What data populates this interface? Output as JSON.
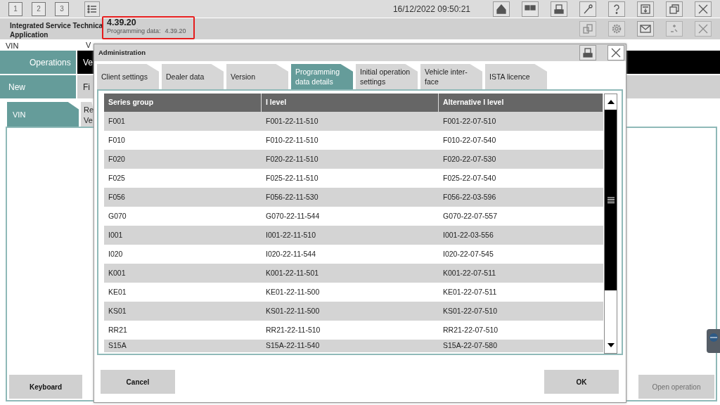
{
  "toolbar": {
    "screens": [
      "1",
      "2",
      "3"
    ],
    "datetime": "16/12/2022 09:50:21"
  },
  "header": {
    "app_title_lines": [
      "Integrated Service Technica",
      "Application"
    ],
    "version": "4.39.20",
    "programming_data_label": "Programming data:",
    "programming_data_value": "4.39.20"
  },
  "background": {
    "vin_label": "VIN",
    "vehicle_label": "V",
    "nav": [
      {
        "label": "Operations",
        "cut_text": "Ve"
      },
      {
        "label": "New",
        "cut_text": "Fi"
      }
    ],
    "subtabs": [
      {
        "label": "VIN",
        "selected": true
      },
      {
        "label": "Re Ve",
        "selected": false
      }
    ],
    "keyboard_button": "Keyboard",
    "open_operation_button": {
      "label": "Open operation",
      "disabled": true
    }
  },
  "dialog": {
    "title": "Administration",
    "tabs": [
      {
        "label": "Client settings",
        "selected": false
      },
      {
        "label": "Dealer data",
        "selected": false
      },
      {
        "label": "Version",
        "selected": false
      },
      {
        "label": "Programming data details",
        "selected": true
      },
      {
        "label": "Initial operation settings",
        "selected": false
      },
      {
        "label": "Vehicle inter-face",
        "selected": false
      },
      {
        "label": "ISTA licence",
        "selected": false
      }
    ],
    "table": {
      "columns": [
        "Series group",
        "I level",
        "Alternative I level"
      ],
      "rows": [
        [
          "F001",
          "F001-22-11-510",
          "F001-22-07-510"
        ],
        [
          "F010",
          "F010-22-11-510",
          "F010-22-07-540"
        ],
        [
          "F020",
          "F020-22-11-510",
          "F020-22-07-530"
        ],
        [
          "F025",
          "F025-22-11-510",
          "F025-22-07-540"
        ],
        [
          "F056",
          "F056-22-11-530",
          "F056-22-03-596"
        ],
        [
          "G070",
          "G070-22-11-544",
          "G070-22-07-557"
        ],
        [
          "I001",
          "I001-22-11-510",
          "I001-22-03-556"
        ],
        [
          "I020",
          "I020-22-11-544",
          "I020-22-07-545"
        ],
        [
          "K001",
          "K001-22-11-501",
          "K001-22-07-511"
        ],
        [
          "KE01",
          "KE01-22-11-500",
          "KE01-22-07-511"
        ],
        [
          "KS01",
          "KS01-22-11-500",
          "KS01-22-07-510"
        ],
        [
          "RR21",
          "RR21-22-11-510",
          "RR21-22-07-510"
        ],
        [
          "S15A",
          "S15A-22-11-540",
          "S15A-22-07-580"
        ]
      ]
    },
    "buttons": [
      "Cancel",
      "OK"
    ]
  }
}
